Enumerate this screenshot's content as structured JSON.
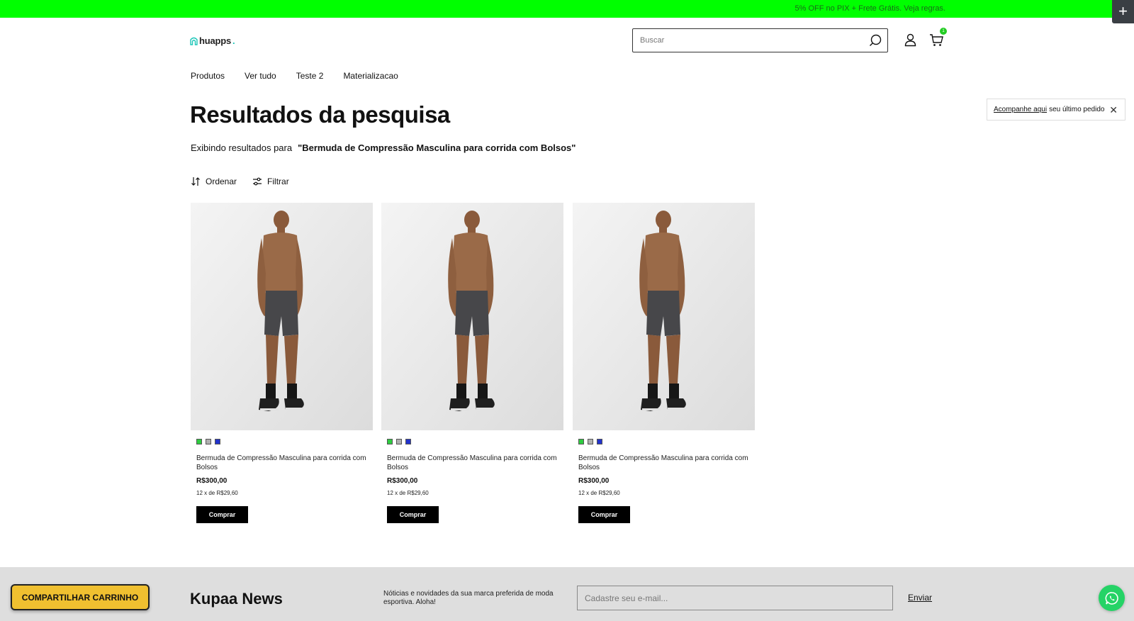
{
  "promo": {
    "text": "5% OFF no PIX + Frete Grátis. Veja regras."
  },
  "header": {
    "logo_text": "huapps",
    "logo_dot": ".",
    "search_placeholder": "Buscar",
    "cart_count": "1"
  },
  "nav": {
    "items": [
      "Produtos",
      "Ver tudo",
      "Teste 2",
      "Materializacao"
    ]
  },
  "page": {
    "title": "Resultados da pesquisa",
    "results_prefix": "Exibindo resultados para",
    "query": "\"Bermuda de Compressão Masculina para corrida com Bolsos\""
  },
  "track_order": {
    "link_text": "Acompanhe aqui",
    "rest_text": "seu último pedido",
    "close_icon": "close-icon"
  },
  "toolbar": {
    "sort_label": "Ordenar",
    "filter_label": "Filtrar"
  },
  "products": [
    {
      "name": "Bermuda de Compressão Masculina para corrida com Bolsos",
      "price": "R$300,00",
      "installments": "12 x de R$29,60",
      "buy_label": "Comprar",
      "swatch_colors": [
        "#2ecc40",
        "#b0b0b0",
        "#2233cc"
      ]
    },
    {
      "name": "Bermuda de Compressão Masculina para corrida com Bolsos",
      "price": "R$300,00",
      "installments": "12 x de R$29,60",
      "buy_label": "Comprar",
      "swatch_colors": [
        "#2ecc40",
        "#b0b0b0",
        "#2233cc"
      ]
    },
    {
      "name": "Bermuda de Compressão Masculina para corrida com Bolsos",
      "price": "R$300,00",
      "installments": "12 x de R$29,60",
      "buy_label": "Comprar",
      "swatch_colors": [
        "#2ecc40",
        "#b0b0b0",
        "#2233cc"
      ]
    }
  ],
  "newsletter": {
    "title": "Kupaa News",
    "description": "Nóticias e novidades da sua marca preferida de moda esportiva. Aloha!",
    "email_placeholder": "Cadastre seu e-mail...",
    "send_label": "Enviar"
  },
  "share_cart": {
    "label": "COMPARTILHAR CARRINHO"
  },
  "colors": {
    "promo_bar": "#00ff00",
    "buy_button": "#000000",
    "share_button": "#f0c030",
    "whatsapp": "#25d366"
  }
}
